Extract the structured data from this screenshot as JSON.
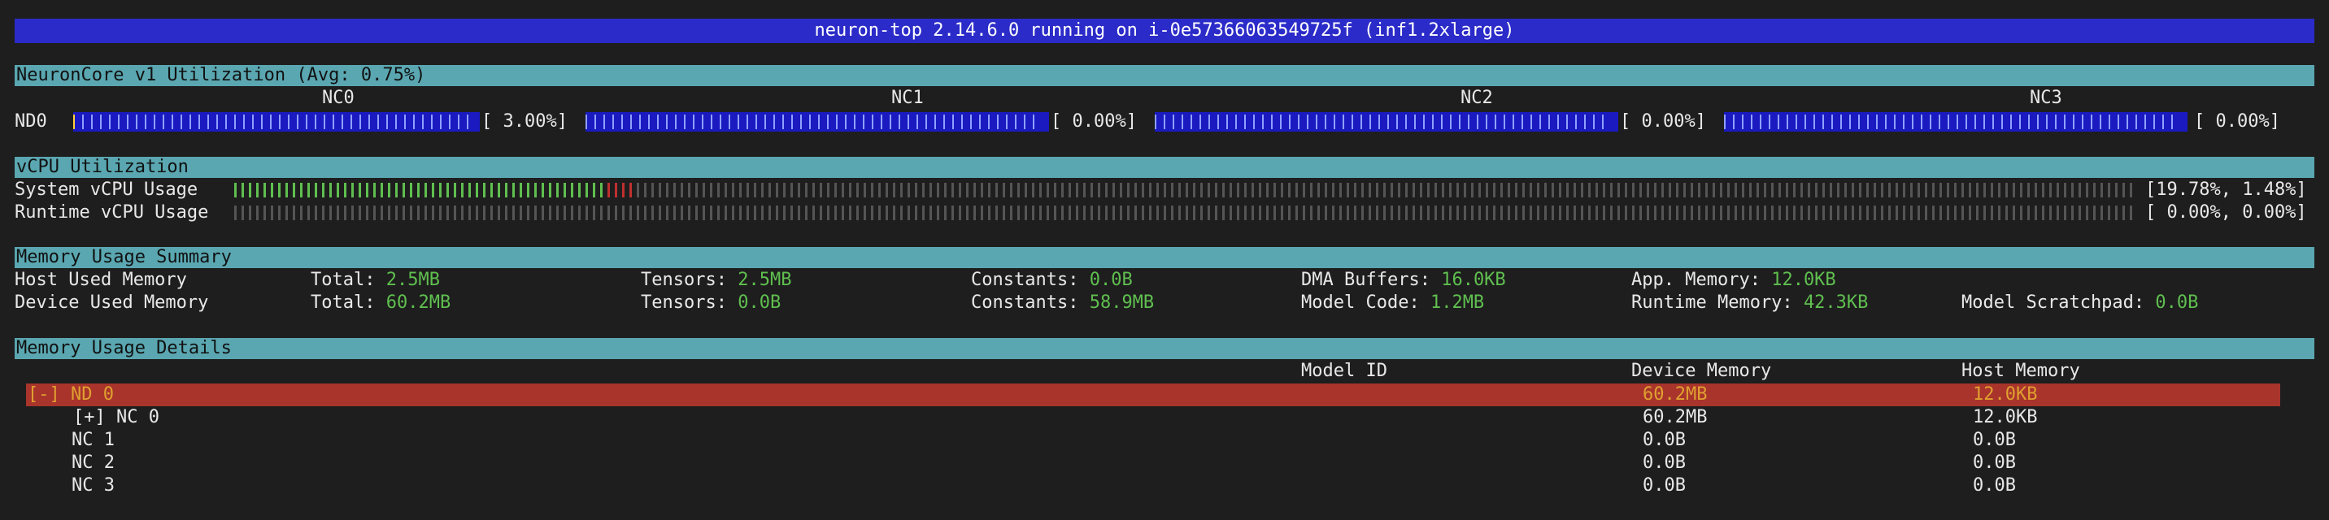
{
  "title": "neuron-top 2.14.6.0 running on i-0e57366063549725f (inf1.2xlarge)",
  "neuroncore": {
    "header": "NeuronCore v1 Utilization (Avg:  0.75%)",
    "device": "ND0",
    "cores": [
      {
        "label": "NC0",
        "pct_text": "[ 3.00%]",
        "utilization": 0.03
      },
      {
        "label": "NC1",
        "pct_text": "[ 0.00%]",
        "utilization": 0.0
      },
      {
        "label": "NC2",
        "pct_text": "[ 0.00%]",
        "utilization": 0.0
      },
      {
        "label": "NC3",
        "pct_text": "[ 0.00%]",
        "utilization": 0.0
      }
    ]
  },
  "vcpu": {
    "header": "vCPU Utilization",
    "system_label": "System vCPU Usage",
    "system_value": "[19.78%, 1.48%]",
    "system_user_pct": 19.78,
    "system_sys_pct": 1.48,
    "runtime_label": "Runtime vCPU Usage",
    "runtime_value": "[ 0.00%, 0.00%]"
  },
  "memory_summary": {
    "header": "Memory Usage Summary",
    "host": {
      "label": "Host Used Memory",
      "total_key": "Total:",
      "total": "2.5MB",
      "tensors_key": "Tensors:",
      "tensors": "2.5MB",
      "constants_key": "Constants:",
      "constants": "0.0B",
      "dma_key": "DMA Buffers:",
      "dma": "16.0KB",
      "app_key": "App. Memory:",
      "app": "12.0KB"
    },
    "device": {
      "label": "Device Used Memory",
      "total_key": "Total:",
      "total": "60.2MB",
      "tensors_key": "Tensors:",
      "tensors": "0.0B",
      "constants_key": "Constants:",
      "constants": "58.9MB",
      "model_code_key": "Model Code:",
      "model_code": "1.2MB",
      "runtime_key": "Runtime Memory:",
      "runtime": "42.3KB",
      "scratch_key": "Model Scratchpad:",
      "scratch": "0.0B"
    }
  },
  "memory_details": {
    "header": "Memory Usage Details",
    "columns": {
      "model_id": "Model ID",
      "device_memory": "Device Memory",
      "host_memory": "Host Memory"
    },
    "rows": [
      {
        "name": "[-] ND 0",
        "device": "60.2MB",
        "host": "12.0KB"
      },
      {
        "name": "[+] NC 0",
        "device": "60.2MB",
        "host": "12.0KB"
      },
      {
        "name": "NC 1",
        "device": "0.0B",
        "host": "0.0B"
      },
      {
        "name": "NC 2",
        "device": "0.0B",
        "host": "0.0B"
      },
      {
        "name": "NC 3",
        "device": "0.0B",
        "host": "0.0B"
      }
    ]
  },
  "colors": {
    "title_bg": "#2b2bc9",
    "section_bg": "#5aa7b1",
    "nc_bar_bg": "#1a1ac0",
    "nc_tick": "#8fa0ff",
    "nc_used": "#ffd040",
    "cpu_user": "#5fbf4f",
    "cpu_sys": "#c03030",
    "cpu_idle": "#555555",
    "selected_row": "#a8342b",
    "value_green": "#5fbf4f"
  }
}
